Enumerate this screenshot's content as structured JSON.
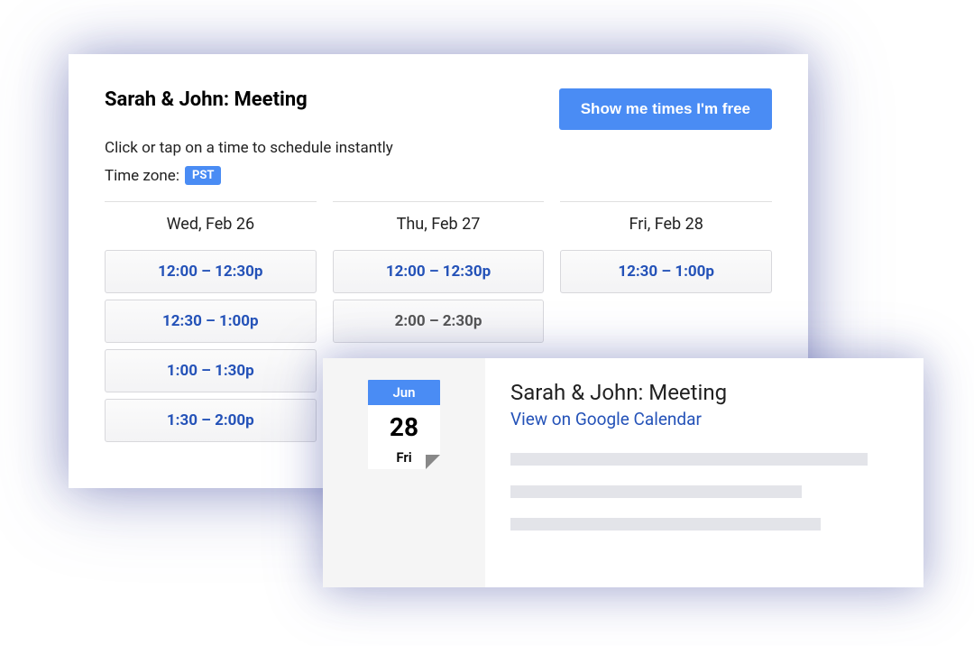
{
  "scheduler": {
    "title": "Sarah & John: Meeting",
    "subtitle": "Click or tap on a time to schedule instantly",
    "timezone_label": "Time zone:",
    "timezone_value": "PST",
    "show_free_label": "Show me times I'm free",
    "days": [
      {
        "header": "Wed, Feb 26",
        "slots": [
          "12:00 – 12:30p",
          "12:30 – 1:00p",
          "1:00 – 1:30p",
          "1:30 – 2:00p"
        ]
      },
      {
        "header": "Thu, Feb 27",
        "slots": [
          "12:00 – 12:30p",
          "2:00 – 2:30p"
        ]
      },
      {
        "header": "Fri, Feb 28",
        "slots": [
          "12:30 – 1:00p"
        ]
      }
    ]
  },
  "detail": {
    "chip": {
      "month": "Jun",
      "day": "28",
      "dow": "Fri"
    },
    "title": "Sarah & John: Meeting",
    "link": "View on Google Calendar"
  }
}
